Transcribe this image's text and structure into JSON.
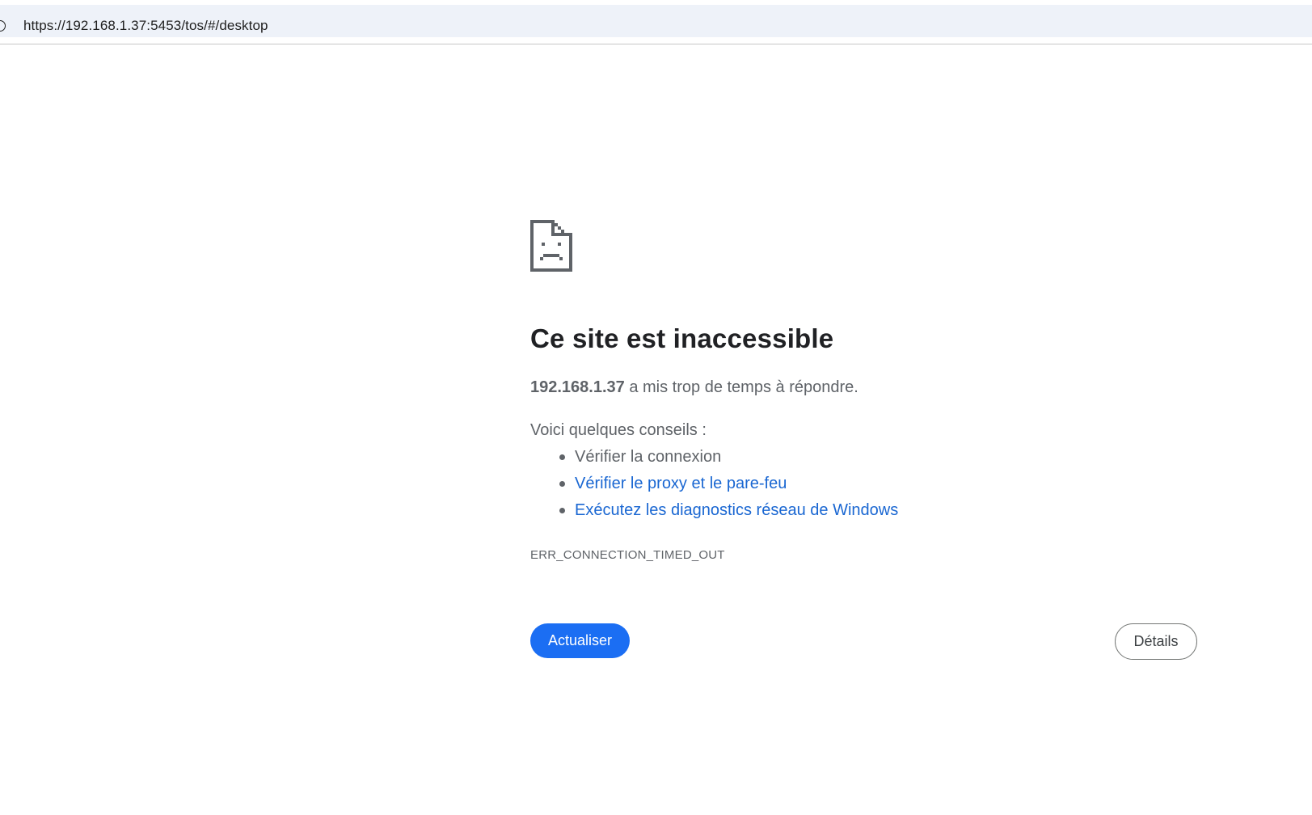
{
  "browser": {
    "url": "https://192.168.1.37:5453/tos/#/desktop",
    "site_info_icon": "info-icon"
  },
  "error_page": {
    "icon": "sad-document-icon",
    "title": "Ce site est inaccessible",
    "host": "192.168.1.37",
    "message_suffix": " a mis trop de temps à répondre.",
    "tips_heading": "Voici quelques conseils :",
    "tips": [
      "Vérifier la connexion",
      "Vérifier le proxy et le pare-feu",
      "Exécutez les diagnostics réseau de Windows"
    ],
    "error_code": "ERR_CONNECTION_TIMED_OUT",
    "reload_label": "Actualiser",
    "details_label": "Détails"
  },
  "colors": {
    "address_bar_bg": "#eef2f9",
    "primary_button": "#1b6ef3",
    "link": "#1a67d2",
    "body_text": "#5f6368",
    "title_text": "#202124"
  }
}
